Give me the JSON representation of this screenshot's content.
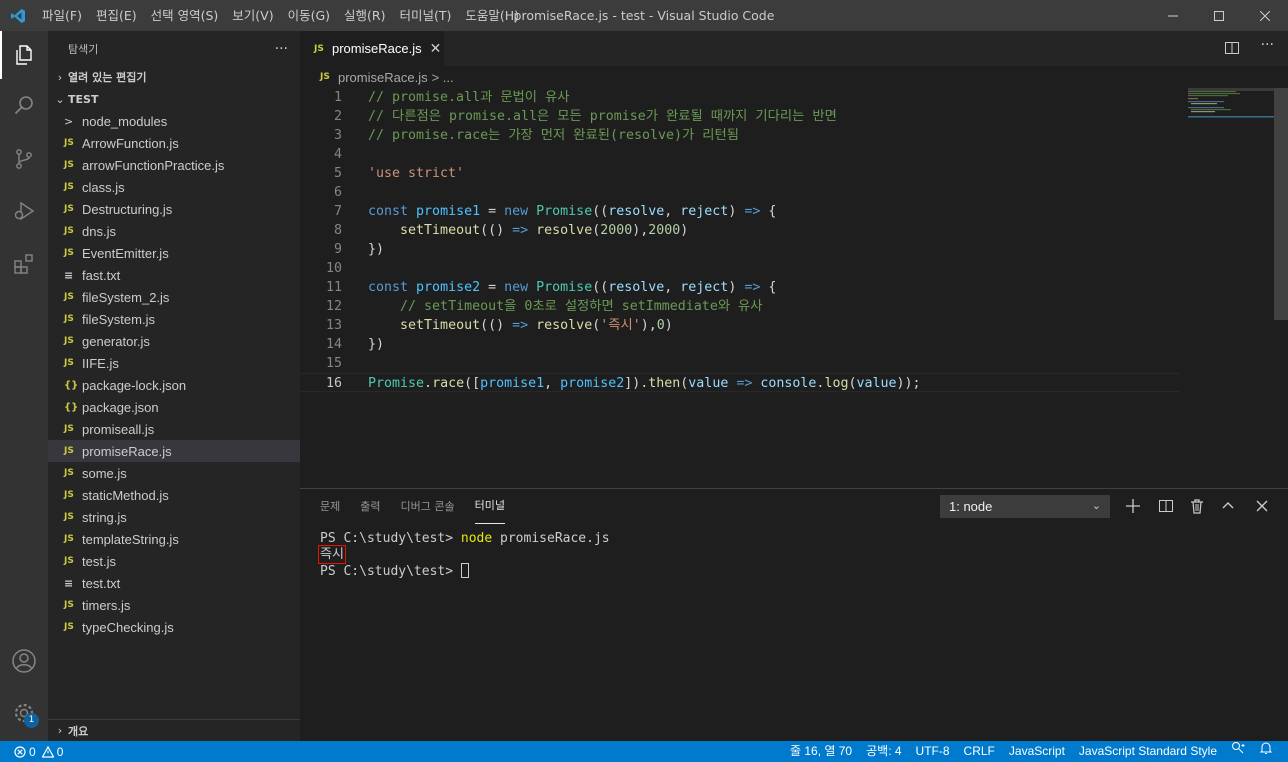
{
  "window": {
    "title": "promiseRace.js - test - Visual Studio Code",
    "menu": [
      "파일(F)",
      "편집(E)",
      "선택 영역(S)",
      "보기(V)",
      "이동(G)",
      "실행(R)",
      "터미널(T)",
      "도움말(H)"
    ]
  },
  "activity": {
    "settings_badge": "1"
  },
  "sidebar": {
    "title": "탐색기",
    "more": "···",
    "open_editors": "열려 있는 편집기",
    "folder": "TEST",
    "files": [
      {
        "name": "node_modules",
        "icon": ">"
      },
      {
        "name": "ArrowFunction.js",
        "icon": "JS"
      },
      {
        "name": "arrowFunctionPractice.js",
        "icon": "JS"
      },
      {
        "name": "class.js",
        "icon": "JS"
      },
      {
        "name": "Destructuring.js",
        "icon": "JS"
      },
      {
        "name": "dns.js",
        "icon": "JS"
      },
      {
        "name": "EventEmitter.js",
        "icon": "JS"
      },
      {
        "name": "fast.txt",
        "icon": "≡"
      },
      {
        "name": "fileSystem_2.js",
        "icon": "JS"
      },
      {
        "name": "fileSystem.js",
        "icon": "JS"
      },
      {
        "name": "generator.js",
        "icon": "JS"
      },
      {
        "name": "IIFE.js",
        "icon": "JS"
      },
      {
        "name": "package-lock.json",
        "icon": "{}"
      },
      {
        "name": "package.json",
        "icon": "{}"
      },
      {
        "name": "promiseall.js",
        "icon": "JS"
      },
      {
        "name": "promiseRace.js",
        "icon": "JS"
      },
      {
        "name": "some.js",
        "icon": "JS"
      },
      {
        "name": "staticMethod.js",
        "icon": "JS"
      },
      {
        "name": "string.js",
        "icon": "JS"
      },
      {
        "name": "templateString.js",
        "icon": "JS"
      },
      {
        "name": "test.js",
        "icon": "JS"
      },
      {
        "name": "test.txt",
        "icon": "≡"
      },
      {
        "name": "timers.js",
        "icon": "JS"
      },
      {
        "name": "typeChecking.js",
        "icon": "JS"
      }
    ],
    "outline": "개요"
  },
  "editor": {
    "tab_icon": "JS",
    "tab_label": "promiseRace.js",
    "tab_close": "✕",
    "breadcrumb_file": "promiseRace.js",
    "breadcrumb_rest": "> ...",
    "lines": [
      {
        "n": "1",
        "t": [
          [
            "c-cmt",
            "// promise.all과 문법이 유사"
          ]
        ]
      },
      {
        "n": "2",
        "t": [
          [
            "c-cmt",
            "// 다른점은 promise.all은 모든 promise가 완료될 때까지 기다리는 반면"
          ]
        ]
      },
      {
        "n": "3",
        "t": [
          [
            "c-cmt",
            "// promise.race는 가장 먼저 완료된(resolve)가 리턴됨"
          ]
        ]
      },
      {
        "n": "4",
        "t": []
      },
      {
        "n": "5",
        "t": [
          [
            "c-str",
            "'use strict'"
          ]
        ]
      },
      {
        "n": "6",
        "t": []
      },
      {
        "n": "7",
        "t": [
          [
            "c-kw",
            "const "
          ],
          [
            "c-var",
            "promise1"
          ],
          [
            "c-pl",
            " = "
          ],
          [
            "c-kw",
            "new "
          ],
          [
            "c-cls",
            "Promise"
          ],
          [
            "c-pl",
            "(("
          ],
          [
            "c-prm",
            "resolve"
          ],
          [
            "c-pl",
            ", "
          ],
          [
            "c-prm",
            "reject"
          ],
          [
            "c-pl",
            ") "
          ],
          [
            "c-kw",
            "=>"
          ],
          [
            "c-pl",
            " {"
          ]
        ]
      },
      {
        "n": "8",
        "t": [
          [
            "c-pl",
            "    "
          ],
          [
            "c-fn",
            "setTimeout"
          ],
          [
            "c-pl",
            "(() "
          ],
          [
            "c-kw",
            "=>"
          ],
          [
            "c-pl",
            " "
          ],
          [
            "c-fn",
            "resolve"
          ],
          [
            "c-pl",
            "("
          ],
          [
            "c-num",
            "2000"
          ],
          [
            "c-pl",
            "),"
          ],
          [
            "c-num",
            "2000"
          ],
          [
            "c-pl",
            ")"
          ]
        ]
      },
      {
        "n": "9",
        "t": [
          [
            "c-pl",
            "})"
          ]
        ]
      },
      {
        "n": "10",
        "t": []
      },
      {
        "n": "11",
        "t": [
          [
            "c-kw",
            "const "
          ],
          [
            "c-var",
            "promise2"
          ],
          [
            "c-pl",
            " = "
          ],
          [
            "c-kw",
            "new "
          ],
          [
            "c-cls",
            "Promise"
          ],
          [
            "c-pl",
            "(("
          ],
          [
            "c-prm",
            "resolve"
          ],
          [
            "c-pl",
            ", "
          ],
          [
            "c-prm",
            "reject"
          ],
          [
            "c-pl",
            ") "
          ],
          [
            "c-kw",
            "=>"
          ],
          [
            "c-pl",
            " {"
          ]
        ]
      },
      {
        "n": "12",
        "t": [
          [
            "c-pl",
            "    "
          ],
          [
            "c-cmt",
            "// setTimeout을 0초로 설정하면 setImmediate와 유사"
          ]
        ]
      },
      {
        "n": "13",
        "t": [
          [
            "c-pl",
            "    "
          ],
          [
            "c-fn",
            "setTimeout"
          ],
          [
            "c-pl",
            "(() "
          ],
          [
            "c-kw",
            "=>"
          ],
          [
            "c-pl",
            " "
          ],
          [
            "c-fn",
            "resolve"
          ],
          [
            "c-pl",
            "("
          ],
          [
            "c-str",
            "'즉시'"
          ],
          [
            "c-pl",
            "),"
          ],
          [
            "c-num",
            "0"
          ],
          [
            "c-pl",
            ")"
          ]
        ]
      },
      {
        "n": "14",
        "t": [
          [
            "c-pl",
            "})"
          ]
        ]
      },
      {
        "n": "15",
        "t": []
      },
      {
        "n": "16",
        "t": [
          [
            "c-cls",
            "Promise"
          ],
          [
            "c-pl",
            "."
          ],
          [
            "c-fn",
            "race"
          ],
          [
            "c-pl",
            "(["
          ],
          [
            "c-var",
            "promise1"
          ],
          [
            "c-pl",
            ", "
          ],
          [
            "c-var",
            "promise2"
          ],
          [
            "c-pl",
            "])."
          ],
          [
            "c-fn",
            "then"
          ],
          [
            "c-pl",
            "("
          ],
          [
            "c-prm",
            "value"
          ],
          [
            "c-pl",
            " "
          ],
          [
            "c-kw",
            "=>"
          ],
          [
            "c-pl",
            " "
          ],
          [
            "c-prm",
            "console"
          ],
          [
            "c-pl",
            "."
          ],
          [
            "c-fn",
            "log"
          ],
          [
            "c-pl",
            "("
          ],
          [
            "c-prm",
            "value"
          ],
          [
            "c-pl",
            "));"
          ]
        ]
      }
    ]
  },
  "panel": {
    "tabs": [
      "문제",
      "출력",
      "디버그 콘솔",
      "터미널"
    ],
    "active_tab": 3,
    "terminal_select": "1: node",
    "terminal": {
      "prompt1": "PS C:\\study\\test> ",
      "cmd": "node",
      "args": " promiseRace.js",
      "output": "즉시",
      "prompt2": "PS C:\\study\\test> "
    }
  },
  "status": {
    "errors": "0",
    "warnings": "0",
    "position": "줄 16, 열 70",
    "indent": "공백: 4",
    "encoding": "UTF-8",
    "eol": "CRLF",
    "language": "JavaScript",
    "style": "JavaScript Standard Style"
  },
  "colors": {
    "accent": "#007acc",
    "title_bar": "#3c3c3c",
    "activity_bar": "#333333",
    "sidebar": "#252526",
    "editor": "#1e1e1e",
    "highlight_box": "#e51400"
  }
}
